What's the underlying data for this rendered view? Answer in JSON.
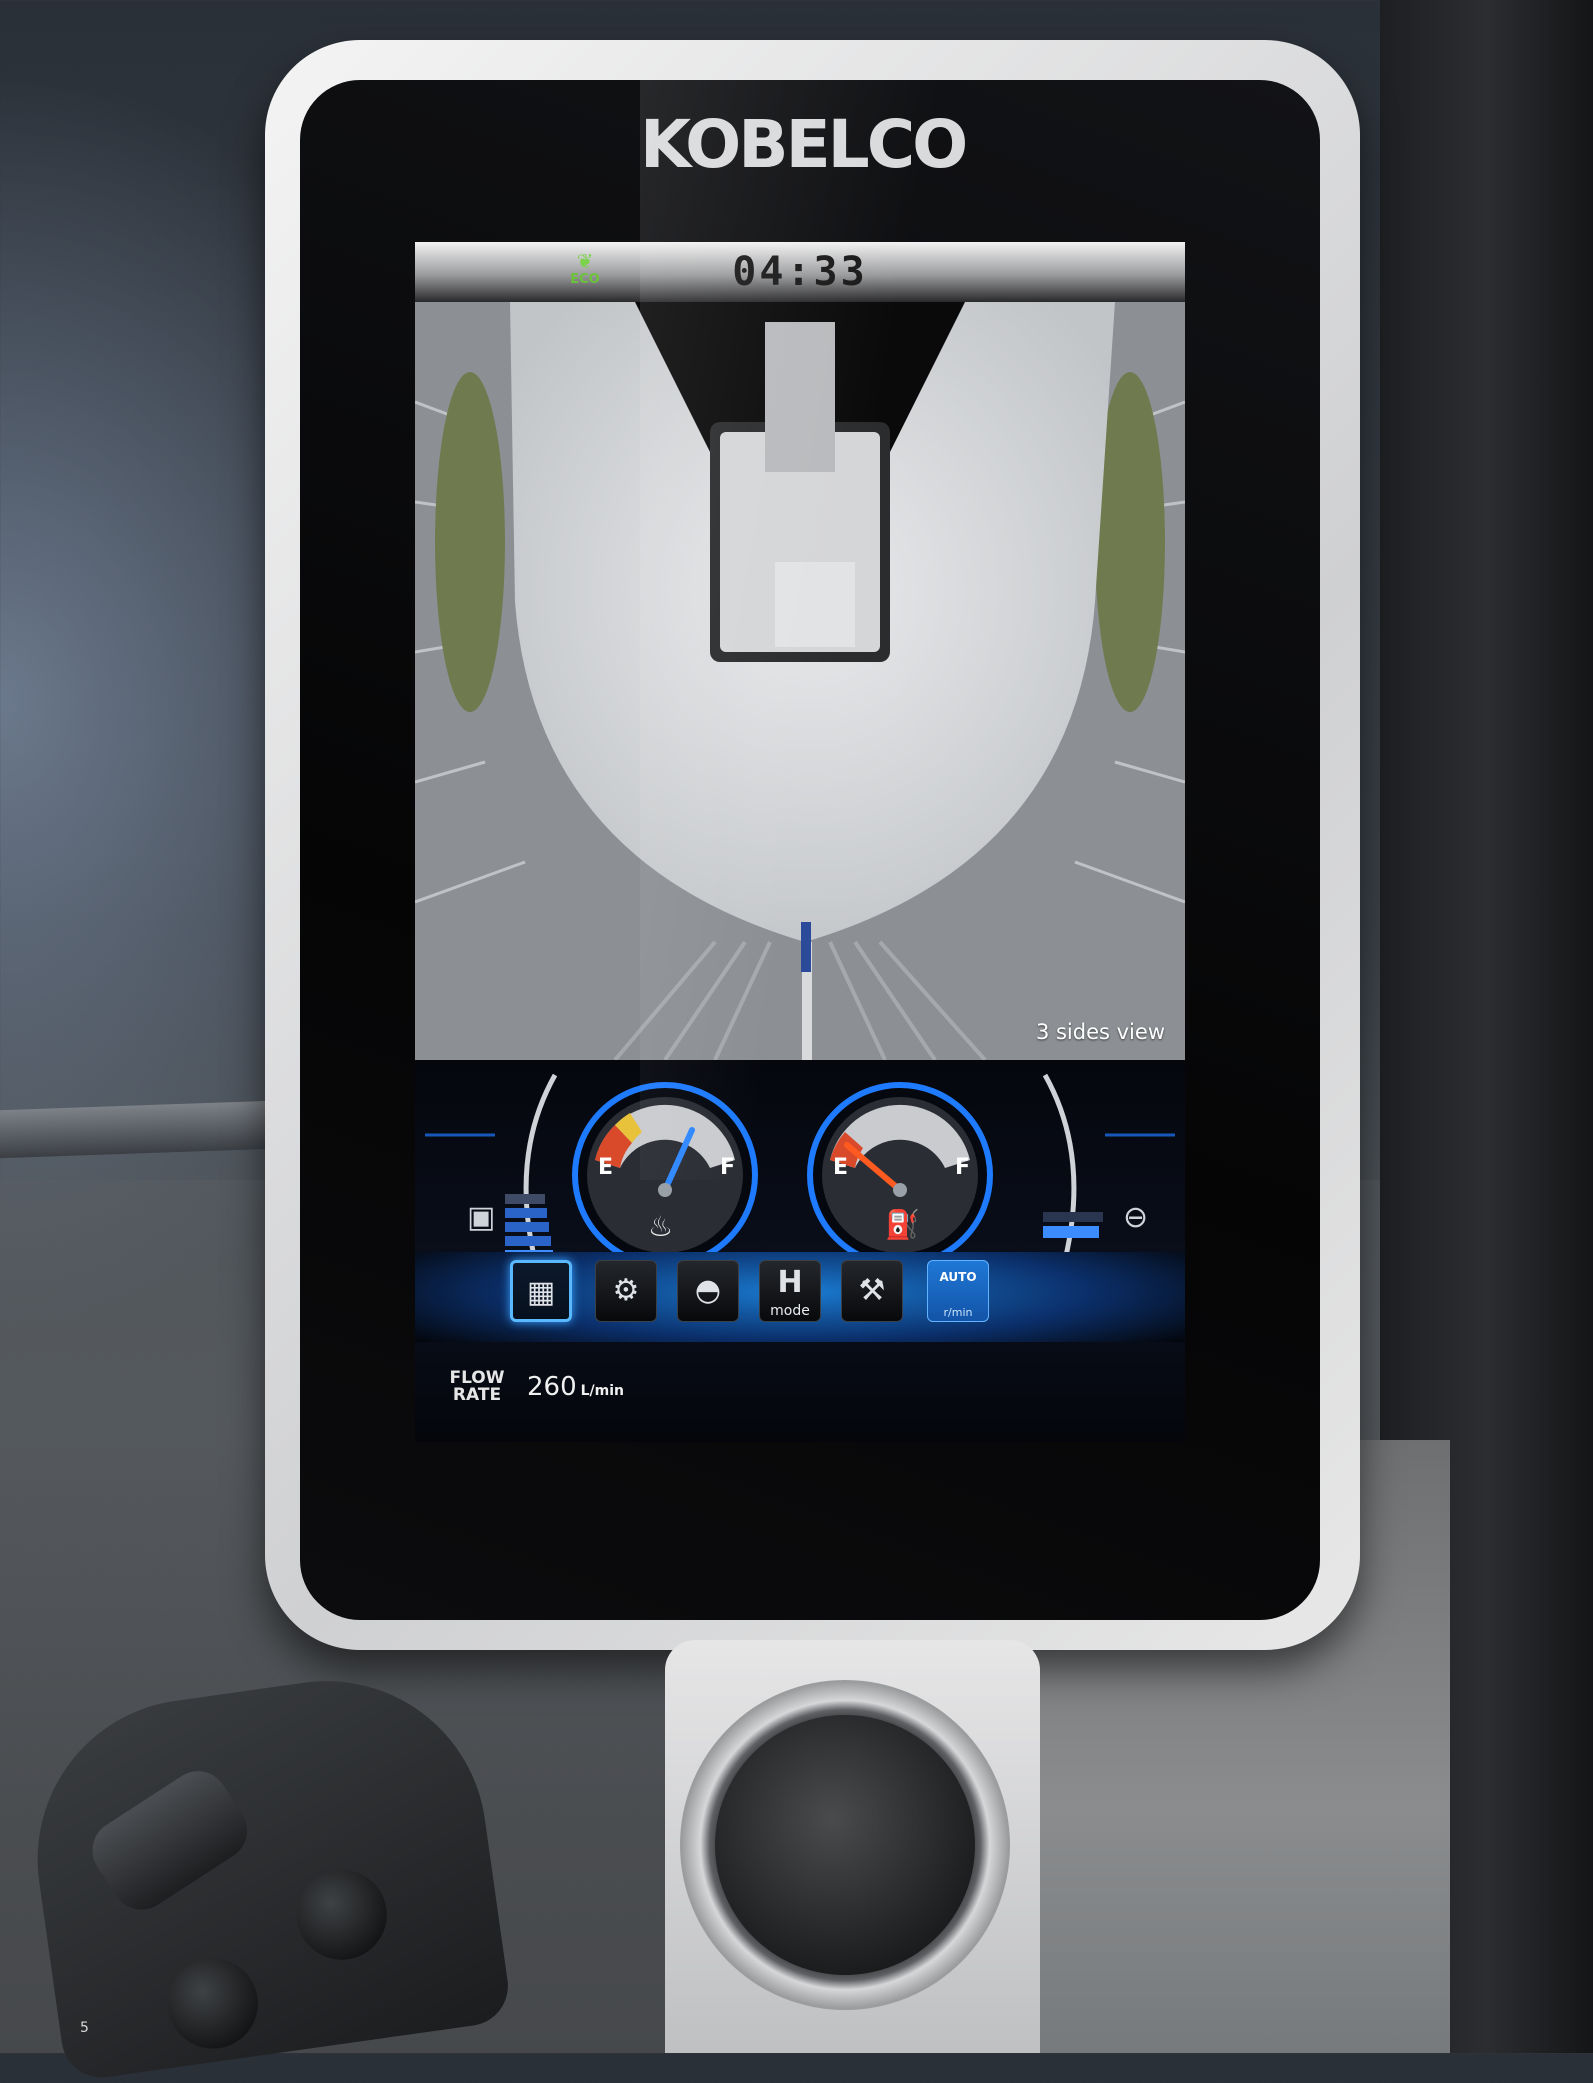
{
  "brand": "KOBELCO",
  "status_bar": {
    "eco_label": "ECO",
    "time": "04:33"
  },
  "camera": {
    "view_label": "3 sides view"
  },
  "gauges": {
    "temperature": {
      "empty_label": "E",
      "full_label": "F",
      "icon": "coolant-temp-icon",
      "level": 0.65
    },
    "fuel": {
      "empty_label": "E",
      "full_label": "F",
      "icon": "fuel-pump-icon",
      "level": 0.2
    },
    "left_bar_icon": "hydraulic-oil-icon",
    "right_bar_icon": "filter-icon",
    "accent_color": "#1e7bff",
    "needle_color_temp": "#2f88ff",
    "needle_color_fuel": "#ff5a1f"
  },
  "toolbar": {
    "buttons": [
      {
        "name": "menu-grid-button",
        "icon": "menu-grid-icon",
        "label": ""
      },
      {
        "name": "settings-button",
        "icon": "gear-icon",
        "label": ""
      },
      {
        "name": "travel-speed-button",
        "icon": "turtle-icon",
        "label": ""
      },
      {
        "name": "h-mode-button",
        "icon": "h-mode-icon",
        "label": "mode"
      },
      {
        "name": "work-light-button",
        "icon": "boom-icon",
        "label": ""
      },
      {
        "name": "auto-idle-button",
        "icon": "auto-idle-icon",
        "label": "AUTO",
        "sub": "r/min"
      }
    ]
  },
  "flow": {
    "label_line1": "FLOW",
    "label_line2": "RATE",
    "value": "260",
    "unit": "L/min"
  },
  "page_number": "5"
}
